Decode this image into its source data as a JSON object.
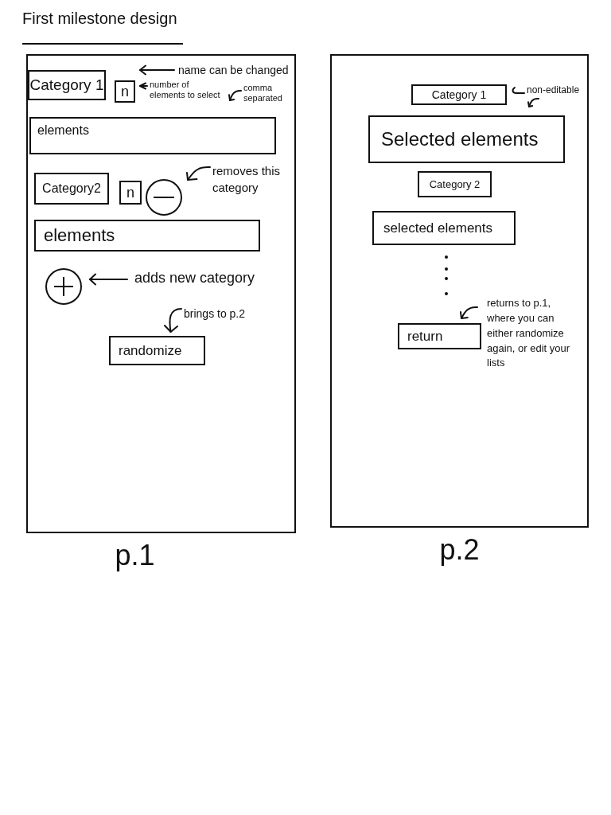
{
  "title": "First milestone design",
  "page_1": {
    "label": "p.1",
    "categories": [
      {
        "name": "Category 1",
        "count": "n",
        "elements": "elements",
        "removable": false,
        "name_note": "name can be changed",
        "count_note": "number of elements to select",
        "elements_note": "comma separated"
      },
      {
        "name": "Category2",
        "count": "n",
        "elements": "elements",
        "removable": true,
        "remove_note": "removes this category"
      }
    ],
    "add_note": "adds new category",
    "randomize_note": "brings to p.2",
    "randomize_button": "randomize"
  },
  "page_2": {
    "label": "p.2",
    "results": [
      {
        "category": "Category 1",
        "elements": "Selected elements",
        "category_note": "non-editable"
      },
      {
        "category": "Category 2",
        "elements": "selected elements"
      }
    ],
    "return_note": "returns to p.1, where you can either randomize again, or edit your lists",
    "return_button": "return"
  }
}
